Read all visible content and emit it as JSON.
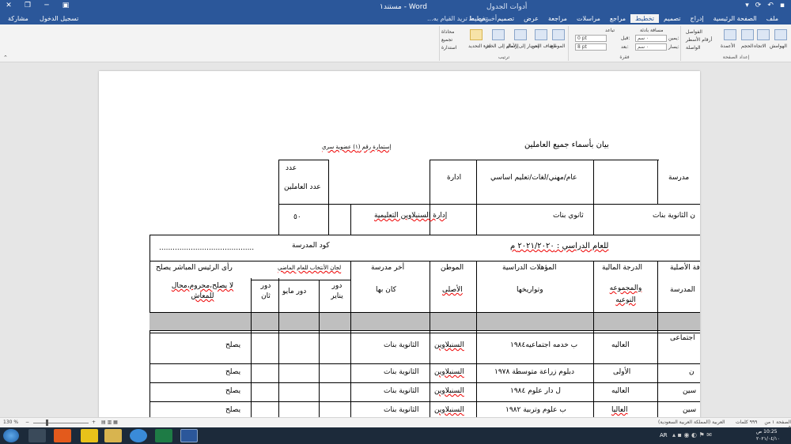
{
  "titlebar": {
    "doc_title": "مستند١ - Word",
    "table_tools": "أدوات الجدول"
  },
  "menubar": {
    "tabs": [
      "ملف",
      "الصفحة الرئيسية",
      "إدراج",
      "تصميم",
      "تخطيط",
      "مراجع",
      "مراسلات",
      "مراجعة",
      "عرض",
      "تصميم",
      "تخطيط"
    ],
    "tell_me": "أخبرني بما تريد القيام به...",
    "signin": "تسجيل الدخول",
    "share": "مشاركة"
  },
  "ribbon": {
    "page_setup_label": "إعداد الصفحة",
    "paragraph_label": "فقرة",
    "arrange_label": "ترتيب",
    "margins": "الهوامش",
    "orientation": "الاتجاه",
    "size": "الحجم",
    "columns": "الأعمدة",
    "breaks": "الفواصل",
    "line_numbers": "أرقام الأسطر",
    "hyphenation": "الواصلة",
    "indent": "مسافة بادئة",
    "spacing": "تباعد",
    "before": "قبل:",
    "after": "بعد:",
    "right": "يمين:",
    "left": "يسار:",
    "indent_val1": "٠ سم",
    "indent_val2": "٠ سم",
    "spacing_before": "0 pt",
    "spacing_after": "8 pt",
    "position": "الموضع",
    "wrap_text": "التفاف النص",
    "bring_forward": "إحضار إلى الأمام",
    "send_backward": "إرسال إلى الخلف",
    "selection_pane": "جزء التحديد",
    "align": "محاذاة",
    "group": "تجميع",
    "rotate": "استدارة"
  },
  "document": {
    "title": "بيان بأسماء جميع العاملين",
    "form_label": "إستمارة رقم (١) عضوية سري",
    "workers_count_label": "عدد العاملين",
    "workers_count_value": "٥٠",
    "admin_label": "ادارة",
    "admin_value": "إدارة السنبلاوين التعليمية",
    "school_type_label": "عام/مهني/لغات/تعليم اساسي",
    "school_type_value": "ثانوي بنات",
    "school_label": "مدرسة",
    "school_value": "ن الثانوية بنات",
    "school_code_label": "كود المدرسة",
    "school_code_value": "..........................................",
    "academic_year": "للعام الدراسي : ٢٠٢١/٢٠٢٠ م",
    "headers": {
      "original_job": "فة الأصلية",
      "school": "المدرسة",
      "fin_grade": "الدرجة المالية",
      "group_type": "والمجموعه النوعيه",
      "qualifications": "المؤهلات الدراسية",
      "and_dates": "وتواريخها",
      "homeland": "الموطن",
      "original": "الأصلى",
      "last_school": "أخر مدرسة",
      "was_in": "كان بها",
      "elect_committees": "لجان الأنتخاب للعام الماضي",
      "jan_round": "دور يناير",
      "may_round": "دور مايو",
      "second_round": "دور ثان",
      "manager_opinion": "رأى الرئيس المباشر يصلح",
      "not_fit": "لا يصلح،محروم،محال للمعاش"
    },
    "rows": [
      {
        "job": "اجتماعى",
        "grade": "العاليه",
        "qual": "ب خدمه اجتماعيه١٩٨٤",
        "home": "السنبلاوين",
        "last": "الثانوية بنات",
        "opinion": "يصلح"
      },
      {
        "job": "ن",
        "grade": "الأولى",
        "qual": "دبلوم زراعة متوسطة ١٩٧٨",
        "home": "السنبلاوين",
        "last": "الثانوية بنات",
        "opinion": "يصلح"
      },
      {
        "job": "سين",
        "grade": "العاليه",
        "qual": "ل دار علوم ١٩٨٤",
        "home": "السنبلاوين",
        "last": "الثانوية بنات",
        "opinion": "يصلح"
      },
      {
        "job": "سين",
        "grade": "العاليا",
        "qual": "ب علوم وتربية ١٩٨٢",
        "home": "السنبلاوين",
        "last": "الثانوية بنات",
        "opinion": "يصلح"
      }
    ]
  },
  "statusbar": {
    "page": "الصفحة ١ من ٥",
    "words": "٩٩٩ كلمات",
    "lang": "العربية (المملكة العربية السعودية)",
    "zoom": "130 %"
  },
  "taskbar": {
    "time": "10:25 ص",
    "date": "٢٠٢١/٠٤/١٠",
    "lang": "AR"
  }
}
